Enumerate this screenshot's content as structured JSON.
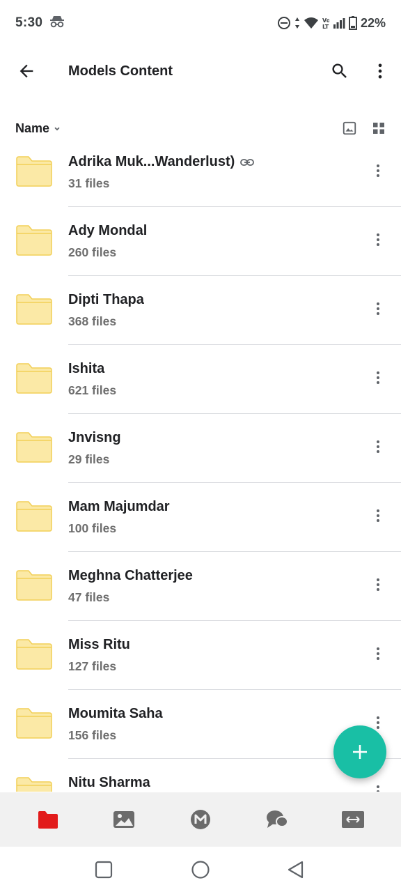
{
  "status": {
    "time": "5:30",
    "battery": "22%",
    "icons": [
      "incognito-icon",
      "dnd-icon",
      "data-arrows-icon",
      "wifi-icon",
      "volte-icon",
      "signal-icon",
      "battery-icon"
    ]
  },
  "app_bar": {
    "title": "Models Content",
    "icons": [
      "back-arrow-icon",
      "search-icon",
      "more-vert-icon"
    ]
  },
  "sort": {
    "label": "Name",
    "icons": [
      "chevron-down-icon",
      "image-view-icon",
      "grid-view-icon"
    ]
  },
  "folders": [
    {
      "name": "Adrika Muk...Wanderlust)",
      "count": "31 files",
      "linked": true
    },
    {
      "name": "Ady Mondal",
      "count": "260 files"
    },
    {
      "name": "Dipti Thapa",
      "count": "368 files"
    },
    {
      "name": "Ishita",
      "count": "621 files"
    },
    {
      "name": "Jnvisng",
      "count": "29 files"
    },
    {
      "name": "Mam Majumdar",
      "count": "100 files"
    },
    {
      "name": "Meghna Chatterjee",
      "count": "47 files"
    },
    {
      "name": "Miss Ritu",
      "count": "127 files"
    },
    {
      "name": "Moumita Saha",
      "count": "156 files"
    },
    {
      "name": "Nitu Sharma",
      "count": ""
    }
  ],
  "fab": {
    "icon": "plus-icon",
    "color": "#19bfa5"
  },
  "bottom_nav": {
    "items": [
      "files-folder-icon",
      "photos-icon",
      "mega-logo-icon",
      "chat-icon",
      "transfers-icon"
    ],
    "active": "files-folder-icon",
    "active_color": "#e21b1b"
  },
  "system_nav": {
    "items": [
      "recents-square-icon",
      "home-circle-icon",
      "back-triangle-icon"
    ]
  },
  "colors": {
    "folder": "#fbe9a6",
    "folder_stroke": "#f2cf57",
    "accent": "#19bfa5"
  }
}
